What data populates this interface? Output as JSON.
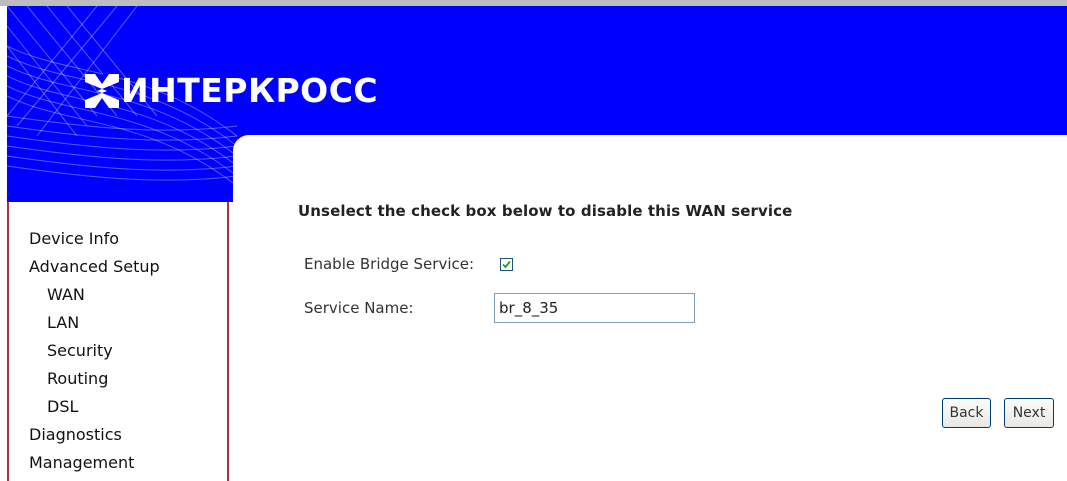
{
  "brand": {
    "name": "ИНТЕРКРОСС",
    "header_color": "#0000ff",
    "border_accent": "#b0304a"
  },
  "sidebar": {
    "items": [
      {
        "label": "Device Info",
        "level": 1
      },
      {
        "label": "Advanced Setup",
        "level": 1
      },
      {
        "label": "WAN",
        "level": 2
      },
      {
        "label": "LAN",
        "level": 2
      },
      {
        "label": "Security",
        "level": 2
      },
      {
        "label": "Routing",
        "level": 2
      },
      {
        "label": "DSL",
        "level": 2
      },
      {
        "label": "Diagnostics",
        "level": 1
      },
      {
        "label": "Management",
        "level": 1
      }
    ]
  },
  "main": {
    "instruction": "Unselect the check box below to disable this WAN service",
    "enable_bridge": {
      "label": "Enable Bridge Service:",
      "checked": true
    },
    "service_name": {
      "label": "Service Name:",
      "value": "br_8_35"
    }
  },
  "buttons": {
    "back": "Back",
    "next": "Next"
  }
}
